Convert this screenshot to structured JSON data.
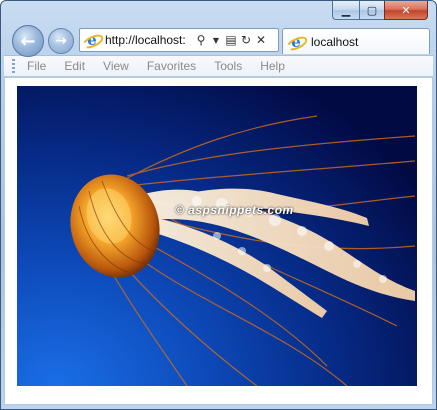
{
  "window": {
    "caption_buttons": {
      "minimize_icon": "minimize-icon",
      "maximize_icon": "maximize-icon",
      "close_icon": "close-icon"
    }
  },
  "nav": {
    "back_icon": "arrow-left-icon",
    "forward_icon": "arrow-right-icon",
    "address": "http://localhost:",
    "address_icons": [
      "search-icon",
      "dropdown-icon",
      "compatibility-icon",
      "refresh-icon",
      "stop-icon"
    ]
  },
  "tab": {
    "label": "localhost",
    "icon": "ie-logo-icon"
  },
  "menu": {
    "items": [
      "File",
      "Edit",
      "View",
      "Favorites",
      "Tools",
      "Help"
    ]
  },
  "content": {
    "image_subject": "jellyfish",
    "watermark": "© aspsnippets.com"
  },
  "colors": {
    "frame": "#b7cfea",
    "close_button": "#c2452c",
    "menu_text": "#8a8a8a",
    "photo_background": "#062a86"
  }
}
